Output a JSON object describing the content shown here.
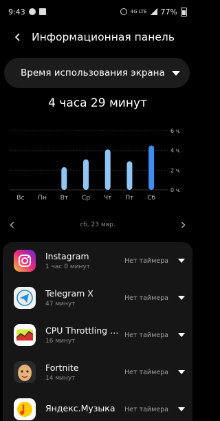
{
  "status_bar": {
    "time": "9:43",
    "network": "4G\nLTE",
    "battery": "77%"
  },
  "header": {
    "title": "Информационная панель"
  },
  "dropdown": {
    "label": "Время использования экрана"
  },
  "total": "4 часа 29 минут",
  "chart_data": {
    "type": "bar",
    "categories": [
      "Вс",
      "Пн",
      "Вт",
      "Ср",
      "Чт",
      "Пт",
      "Сб"
    ],
    "values": [
      0,
      0,
      2.3,
      3.1,
      4.1,
      2.9,
      4.5
    ],
    "ylim": [
      0,
      6
    ],
    "yticks": [
      {
        "value": 0,
        "label": "0 ч."
      },
      {
        "value": 2,
        "label": "2 ч."
      },
      {
        "value": 4,
        "label": "4 ч."
      },
      {
        "value": 6,
        "label": "6 ч."
      }
    ],
    "highlight_index": 6,
    "colors": {
      "bar": "#8fc6f5",
      "highlight": "#3d8ef0",
      "grid": "#333333",
      "label": "#bdbdbd"
    }
  },
  "date_nav": {
    "date": "сб, 23 мар."
  },
  "apps": [
    {
      "name": "Instagram",
      "time": "1 час 0 минут",
      "timer": "Нет таймера",
      "icon": "instagram-icon"
    },
    {
      "name": "Telegram X",
      "time": "47 минут",
      "timer": "Нет таймера",
      "icon": "telegram-icon"
    },
    {
      "name": "CPU Throttling Test",
      "time": "16 минут",
      "timer": "Нет таймера",
      "icon": "cpu-throttling-icon"
    },
    {
      "name": "Fortnite",
      "time": "14 минут",
      "timer": "Нет таймера",
      "icon": "fortnite-icon"
    },
    {
      "name": "Яндекс.Музыка",
      "time": "",
      "timer": "Нет таймера",
      "icon": "yandex-music-icon"
    }
  ]
}
